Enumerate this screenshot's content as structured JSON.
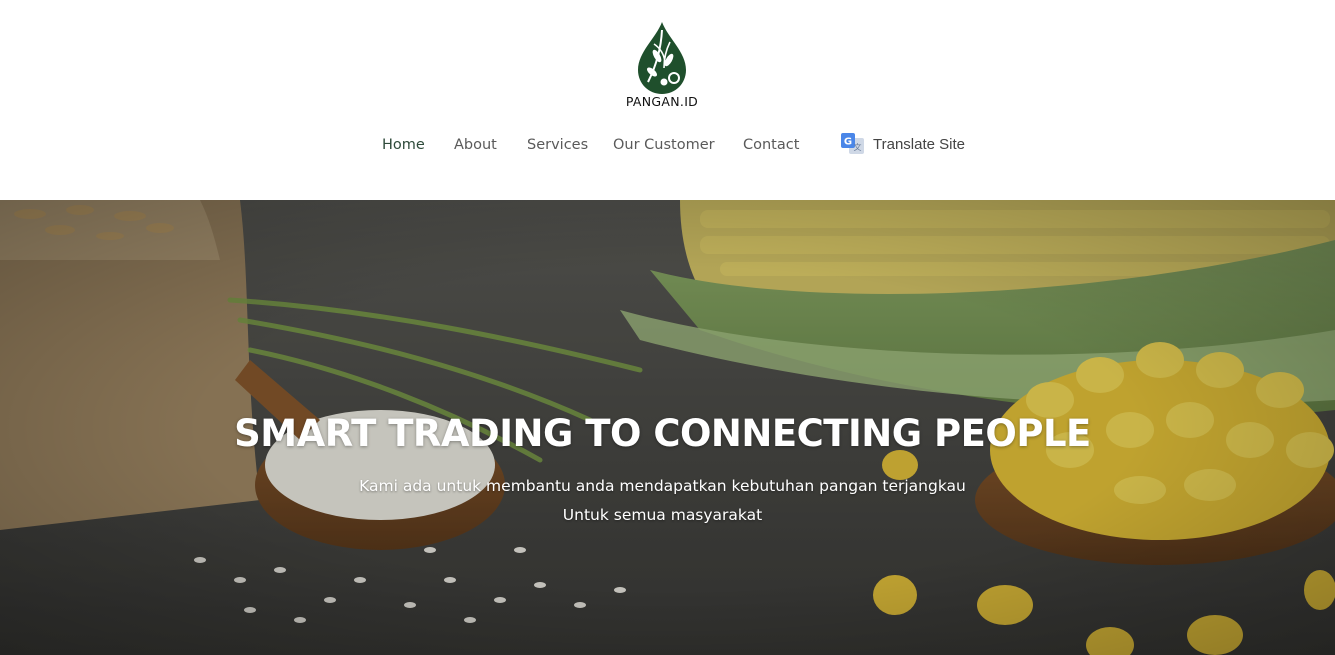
{
  "brand": {
    "name": "PANGAN.ID",
    "color": "#1f4f2c"
  },
  "nav": {
    "items": [
      {
        "label": "Home",
        "active": true
      },
      {
        "label": "About",
        "active": false
      },
      {
        "label": "Services",
        "active": false
      },
      {
        "label": "Our Customer",
        "active": false
      },
      {
        "label": "Contact",
        "active": false
      }
    ],
    "translate_label": "Translate Site",
    "translate_icon": "google-translate-icon"
  },
  "hero": {
    "title": "SMART TRADING TO CONNECTING PEOPLE",
    "subtitle_line1": "Kami ada untuk membantu anda mendapatkan kebutuhan pangan terjangkau",
    "subtitle_line2": "Untuk semua masyarakat",
    "background": "rice and corn food photo"
  }
}
